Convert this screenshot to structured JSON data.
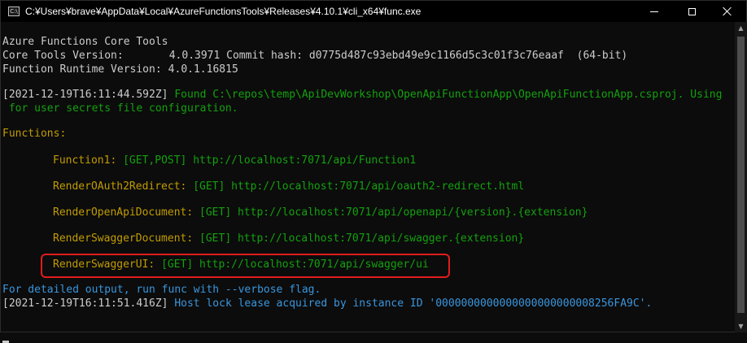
{
  "window": {
    "title": "C:¥Users¥brave¥AppData¥Local¥AzureFunctionsTools¥Releases¥4.10.1¥cli_x64¥func.exe",
    "icon": "console-app-icon",
    "icon_text": "C:\\"
  },
  "console": {
    "header": {
      "title": "Azure Functions Core Tools",
      "core_version_label": "Core Tools Version:",
      "core_version_value": "4.0.3971 Commit hash: d0775d487c93ebd49e9c1166d5c3c01f3c76eaaf  (64-bit)",
      "runtime_label": "Function Runtime Version:",
      "runtime_value": "4.0.1.16815"
    },
    "log1": {
      "timestamp": "[2021-12-19T16:11:44.592Z]",
      "message_line1": " Found C:\\repos\\temp\\ApiDevWorkshop\\OpenApiFunctionApp\\OpenApiFunctionApp.csproj. Using",
      "message_line2": " for user secrets file configuration."
    },
    "functions_heading": "Functions:",
    "functions": [
      {
        "name": "Function1:",
        "methods": "[GET,POST]",
        "url": "http://localhost:7071/api/Function1"
      },
      {
        "name": "RenderOAuth2Redirect:",
        "methods": "[GET]",
        "url": "http://localhost:7071/api/oauth2-redirect.html"
      },
      {
        "name": "RenderOpenApiDocument:",
        "methods": "[GET]",
        "url": "http://localhost:7071/api/openapi/{version}.{extension}"
      },
      {
        "name": "RenderSwaggerDocument:",
        "methods": "[GET]",
        "url": "http://localhost:7071/api/swagger.{extension}"
      },
      {
        "name": "RenderSwaggerUI:",
        "methods": "[GET]",
        "url": "http://localhost:7071/api/swagger/ui"
      }
    ],
    "verbose_hint": "For detailed output, run func with --verbose flag.",
    "log2": {
      "timestamp": "[2021-12-19T16:11:51.416Z]",
      "message": " Host lock lease acquired by instance ID '0000000000000000000000008256FA9C'."
    }
  },
  "colors": {
    "background": "#0c0c0c",
    "text_default": "#cccccc",
    "text_green": "#13a10e",
    "text_yellow": "#c19c00",
    "text_blue": "#3a96dd",
    "highlight_border": "#e21c1c"
  }
}
